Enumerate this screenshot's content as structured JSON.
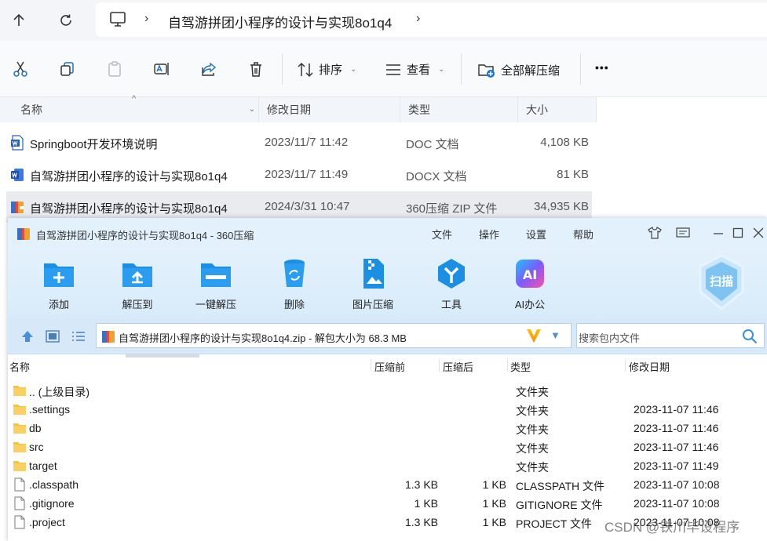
{
  "explorer": {
    "breadcrumb": "自驾游拼团小程序的设计与实现8o1q4",
    "commands": {
      "sort": "排序",
      "view": "查看",
      "extract_all": "全部解压缩",
      "more": "•••"
    },
    "columns": {
      "name": "名称",
      "modified": "修改日期",
      "type": "类型",
      "size": "大小"
    },
    "files": [
      {
        "name": "Springboot开发环境说明",
        "modified": "2023/11/7 11:42",
        "type": "DOC 文档",
        "size": "4,108 KB",
        "icon": "word-doc-icon"
      },
      {
        "name": "自驾游拼团小程序的设计与实现8o1q4",
        "modified": "2023/11/7 11:49",
        "type": "DOCX 文档",
        "size": "81 KB",
        "icon": "word-docx-icon"
      },
      {
        "name": "自驾游拼团小程序的设计与实现8o1q4",
        "modified": "2024/3/31 10:47",
        "type": "360压缩 ZIP 文件",
        "size": "34,935 KB",
        "icon": "zip-archive-icon"
      }
    ]
  },
  "zip_window": {
    "title": "自驾游拼团小程序的设计与实现8o1q4 - 360压缩",
    "menu": [
      "文件",
      "操作",
      "设置",
      "帮助"
    ],
    "tools": [
      {
        "label": "添加",
        "icon": "add-folder-icon"
      },
      {
        "label": "解压到",
        "icon": "extract-to-icon"
      },
      {
        "label": "一键解压",
        "icon": "one-click-extract-icon"
      },
      {
        "label": "删除",
        "icon": "delete-bin-icon"
      },
      {
        "label": "图片压缩",
        "icon": "image-compress-icon"
      },
      {
        "label": "工具",
        "icon": "tools-icon"
      },
      {
        "label": "AI办公",
        "icon": "ai-office-icon"
      }
    ],
    "scan_label": "扫描",
    "path": "自驾游拼团小程序的设计与实现8o1q4.zip - 解包大小为 68.3 MB",
    "search_placeholder": "搜索包内文件",
    "columns": {
      "name": "名称",
      "before": "压缩前",
      "after": "压缩后",
      "type": "类型",
      "modified": "修改日期"
    },
    "entries": [
      {
        "name": ".. (上级目录)",
        "before": "",
        "after": "",
        "type": "文件夹",
        "modified": "",
        "kind": "folder"
      },
      {
        "name": ".settings",
        "before": "",
        "after": "",
        "type": "文件夹",
        "modified": "2023-11-07 11:46",
        "kind": "folder"
      },
      {
        "name": "db",
        "before": "",
        "after": "",
        "type": "文件夹",
        "modified": "2023-11-07 11:46",
        "kind": "folder"
      },
      {
        "name": "src",
        "before": "",
        "after": "",
        "type": "文件夹",
        "modified": "2023-11-07 11:46",
        "kind": "folder"
      },
      {
        "name": "target",
        "before": "",
        "after": "",
        "type": "文件夹",
        "modified": "2023-11-07 11:49",
        "kind": "folder"
      },
      {
        "name": ".classpath",
        "before": "1.3 KB",
        "after": "1 KB",
        "type": "CLASSPATH 文件",
        "modified": "2023-11-07 10:08",
        "kind": "file"
      },
      {
        "name": ".gitignore",
        "before": "1 KB",
        "after": "1 KB",
        "type": "GITIGNORE 文件",
        "modified": "2023-11-07 10:08",
        "kind": "file"
      },
      {
        "name": ".project",
        "before": "1.3 KB",
        "after": "1 KB",
        "type": "PROJECT 文件",
        "modified": "2023-11-07 10:08",
        "kind": "file"
      }
    ]
  },
  "watermark": "CSDN @铁川毕设程序",
  "colors": {
    "accent_blue": "#1a8fe3",
    "selected_row": "#e9ebef",
    "zip_title_bg": "#e3f1fc",
    "folder_yellow": "#f5c542"
  }
}
